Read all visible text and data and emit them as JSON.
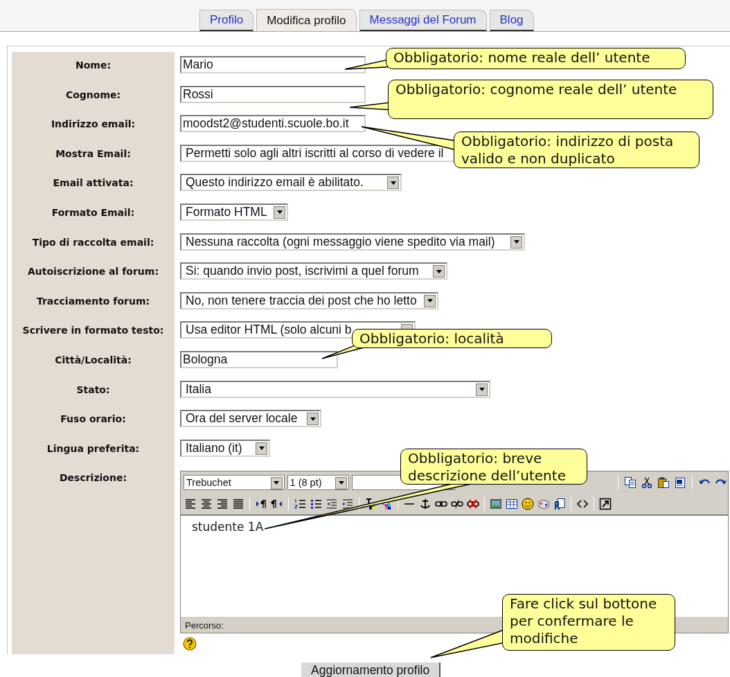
{
  "tabs": [
    {
      "label": "Profilo",
      "selected": false
    },
    {
      "label": "Modifica profilo",
      "selected": true
    },
    {
      "label": "Messaggi del Forum",
      "selected": false
    },
    {
      "label": "Blog",
      "selected": false
    }
  ],
  "fields": [
    {
      "label": "Nome:",
      "kind": "input",
      "value": "Mario"
    },
    {
      "label": "Cognome:",
      "kind": "input",
      "value": "Rossi"
    },
    {
      "label": "Indirizzo email:",
      "kind": "input",
      "value": "moodst2@studenti.scuole.bo.it"
    },
    {
      "label": "Mostra Email:",
      "kind": "select",
      "value": "Permetti solo agli altri iscritti al corso di vedere il"
    },
    {
      "label": "Email attivata:",
      "kind": "select",
      "value": "Questo indirizzo email è abilitato."
    },
    {
      "label": "Formato Email:",
      "kind": "select",
      "value": "Formato HTML"
    },
    {
      "label": "Tipo di raccolta email:",
      "kind": "select",
      "value": "Nessuna raccolta (ogni messaggio viene spedito via mail)"
    },
    {
      "label": "Autoiscrizione al forum:",
      "kind": "select",
      "value": "Si: quando invio post, iscrivimi a quel forum"
    },
    {
      "label": "Tracciamento forum:",
      "kind": "select",
      "value": "No, non tenere traccia dei post che ho letto"
    },
    {
      "label": "Scrivere in formato testo:",
      "kind": "select",
      "value": "Usa editor HTML (solo alcuni b"
    },
    {
      "label": "Città/Località:",
      "kind": "input",
      "value": "Bologna"
    },
    {
      "label": "Stato:",
      "kind": "select",
      "value": "Italia"
    },
    {
      "label": "Fuso orario:",
      "kind": "select",
      "value": "Ora del server locale"
    },
    {
      "label": "Lingua preferita:",
      "kind": "select",
      "value": "Italiano (it)"
    }
  ],
  "editor": {
    "label": "Descrizione:",
    "font": "Trebuchet",
    "size": "1 (8 pt)",
    "content": "studente 1A",
    "path_label": "Percorso:"
  },
  "submit": "Aggiornamento profilo",
  "callouts": [
    {
      "text": "Obbligatorio: nome reale dell’ utente"
    },
    {
      "text": "Obbligatorio: cognome reale dell’ utente"
    },
    {
      "text": "Obbligatorio: indirizzo di posta valido e non duplicato"
    },
    {
      "text": "Obbligatorio: località"
    },
    {
      "text": "Obbligatorio: breve descrizione dell’utente"
    },
    {
      "text": "Fare click sul bottone per confermare le modifiche"
    }
  ]
}
